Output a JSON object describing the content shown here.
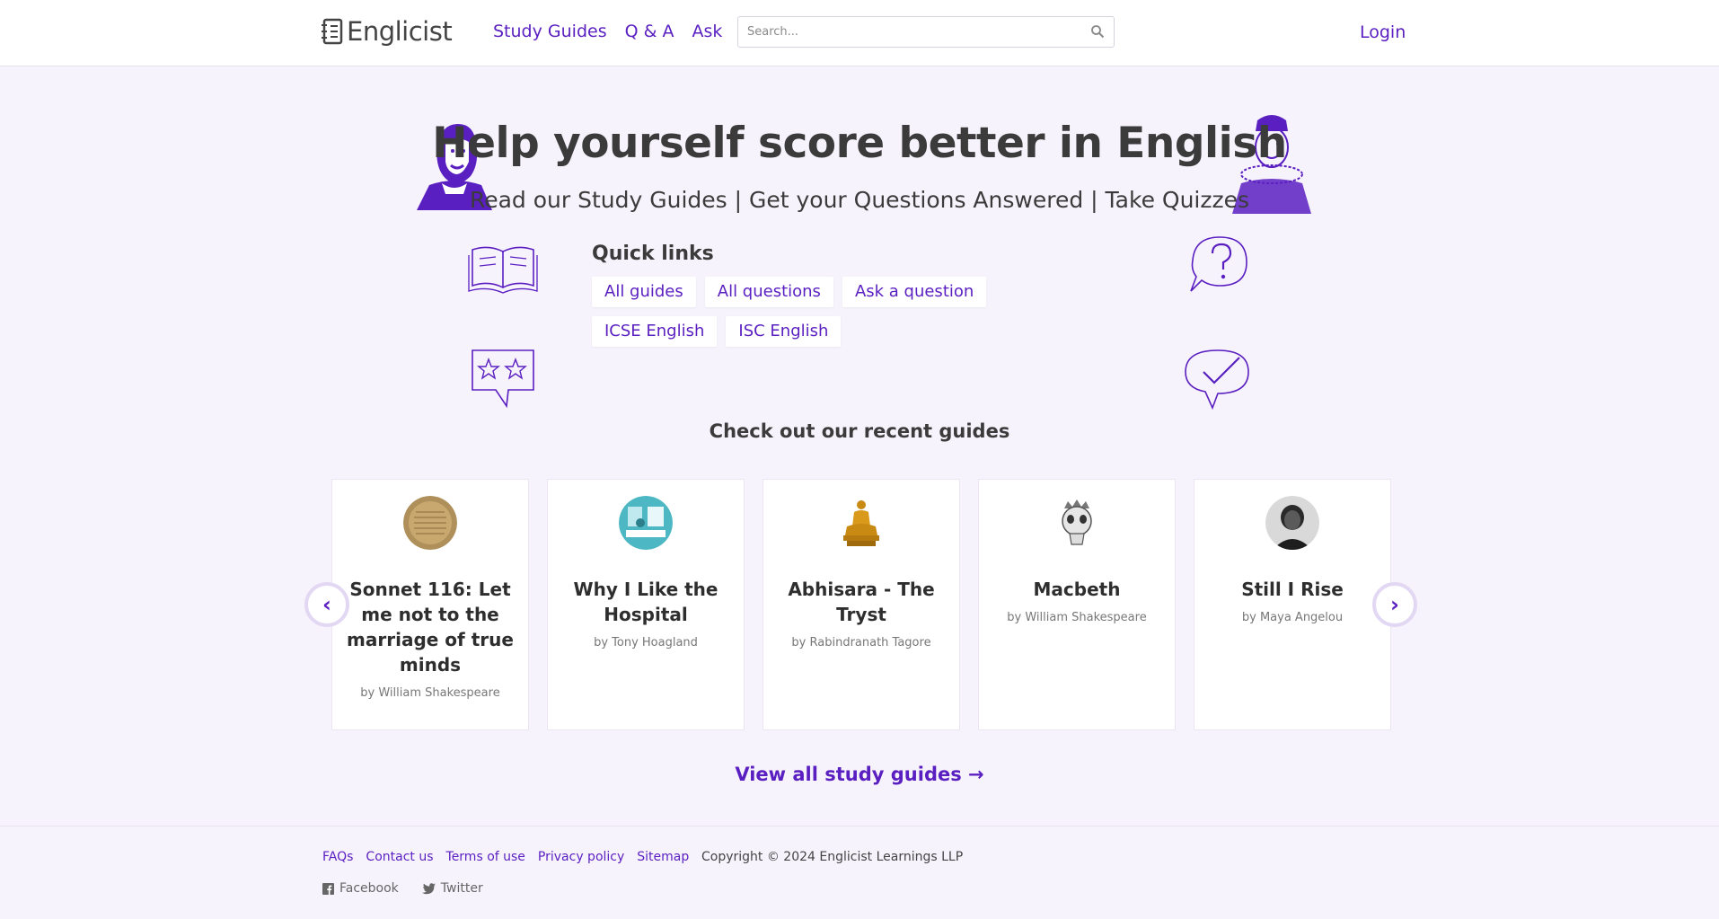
{
  "header": {
    "logo_text": "Englicist",
    "nav": [
      "Study Guides",
      "Q & A",
      "Ask"
    ],
    "search_placeholder": "Search...",
    "login": "Login"
  },
  "hero": {
    "title": "Help yourself score better in English",
    "subtitle": "Read our Study Guides | Get your Questions Answered | Take Quizzes"
  },
  "quick_links": {
    "title": "Quick links",
    "items": [
      "All guides",
      "All questions",
      "Ask a question",
      "ICSE English",
      "ISC English"
    ]
  },
  "recent": {
    "title": "Check out our recent guides",
    "cards": [
      {
        "title": "Sonnet 116: Let me not to the marriage of true minds",
        "author": "by William Shakespeare"
      },
      {
        "title": "Why I Like the Hospital",
        "author": "by Tony Hoagland"
      },
      {
        "title": "Abhisara - The Tryst",
        "author": "by Rabindranath Tagore"
      },
      {
        "title": "Macbeth",
        "author": "by William Shakespeare"
      },
      {
        "title": "Still I Rise",
        "author": "by Maya Angelou"
      }
    ],
    "prev": "‹",
    "next": "›"
  },
  "view_all": "View all study guides →",
  "footer": {
    "links": [
      "FAQs",
      "Contact us",
      "Terms of use",
      "Privacy policy",
      "Sitemap"
    ],
    "copyright": "Copyright © 2024 Englicist Learnings LLP",
    "social": [
      "Facebook",
      "Twitter"
    ]
  },
  "colors": {
    "accent": "#5a1fc1",
    "background": "#f7f3fc"
  }
}
